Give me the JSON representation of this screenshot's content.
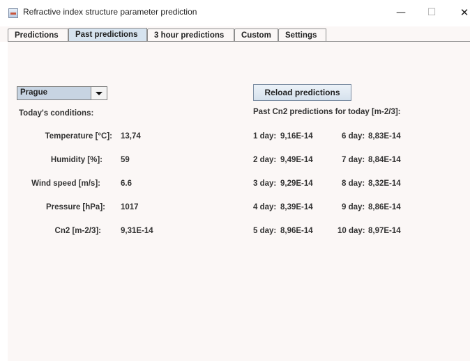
{
  "window": {
    "title": "Refractive index structure parameter prediction",
    "icon": "java-cup-icon"
  },
  "tabs": [
    {
      "label": "Predictions"
    },
    {
      "label": "Past predictions"
    },
    {
      "label": "3 hour predictions"
    },
    {
      "label": "Custom"
    },
    {
      "label": "Settings"
    }
  ],
  "active_tab": "Past predictions",
  "location": {
    "selected": "Prague"
  },
  "conditions": {
    "heading": "Today's conditions:",
    "rows": [
      {
        "label": "Temperature [°C]:",
        "value": "13,74"
      },
      {
        "label": "Humidity [%]:",
        "value": "59"
      },
      {
        "label": "Wind speed [m/s]:",
        "value": "6.6"
      },
      {
        "label": "Pressure [hPa]:",
        "value": "1017"
      },
      {
        "label": "Cn2 [m-2/3]:",
        "value": "9,31E-14"
      }
    ]
  },
  "past": {
    "reload_label": "Reload predictions",
    "heading": "Past Cn2 predictions for today [m-2/3]:",
    "left": [
      {
        "label": "1 day:",
        "value": "9,16E-14"
      },
      {
        "label": "2 day:",
        "value": "9,49E-14"
      },
      {
        "label": "3 day:",
        "value": "9,29E-14"
      },
      {
        "label": "4 day:",
        "value": "8,39E-14"
      },
      {
        "label": "5 day:",
        "value": "8,96E-14"
      }
    ],
    "right": [
      {
        "label": "6 day:",
        "value": "8,83E-14"
      },
      {
        "label": "7 day:",
        "value": "8,84E-14"
      },
      {
        "label": "8 day:",
        "value": "8,32E-14"
      },
      {
        "label": "9 day:",
        "value": "8,86E-14"
      },
      {
        "label": "10 day:",
        "value": "8,97E-14"
      }
    ]
  }
}
